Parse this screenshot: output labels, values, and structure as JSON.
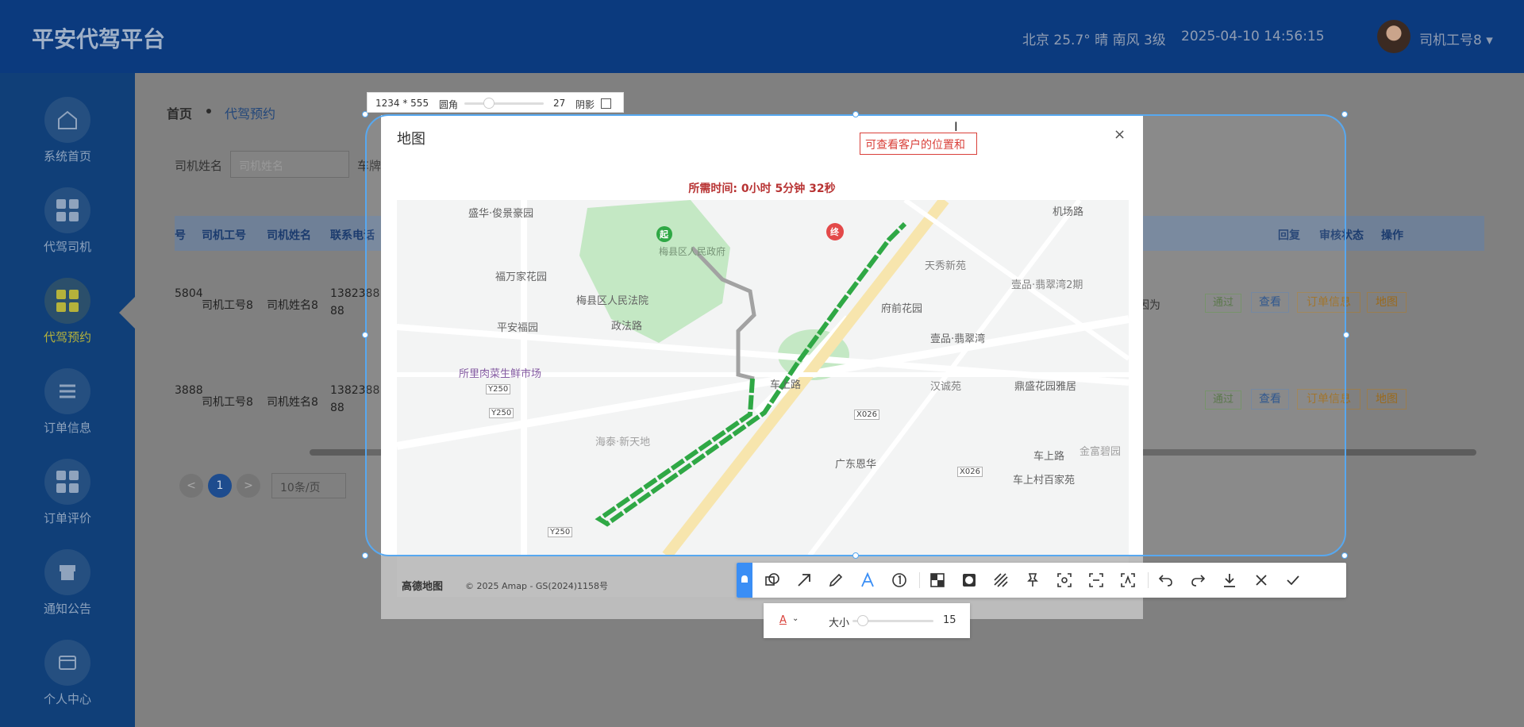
{
  "header": {
    "brand": "平安代驾平台",
    "weather": "北京 25.7° 晴 南风 3级",
    "datetime": "2025-04-10 14:56:15",
    "user": "司机工号8 ▾"
  },
  "sidebar": {
    "items": [
      {
        "label": "系统首页",
        "icon": "home-icon"
      },
      {
        "label": "代驾司机",
        "icon": "grid-icon"
      },
      {
        "label": "代驾预约",
        "icon": "grid-icon",
        "active": true
      },
      {
        "label": "订单信息",
        "icon": "list-icon"
      },
      {
        "label": "订单评价",
        "icon": "grid-icon"
      },
      {
        "label": "通知公告",
        "icon": "shop-icon"
      },
      {
        "label": "个人中心",
        "icon": "wallet-icon"
      }
    ]
  },
  "breadcrumb": {
    "home": "首页",
    "current": "代驾预约"
  },
  "filters": {
    "driver_name_label": "司机姓名",
    "driver_name_placeholder": "司机姓名",
    "plate_label": "车牌"
  },
  "table": {
    "headers_left": [
      "号",
      "司机工号",
      "司机姓名",
      "联系电话"
    ],
    "headers_right": [
      "回复",
      "审核状态",
      "操作"
    ],
    "rows": [
      {
        "id_tail": "5804",
        "driver_no": "司机工号8",
        "driver_name": "司机姓名8",
        "phone_a": "1382388",
        "phone_b": "88",
        "reply": "、因为",
        "status": "通过"
      },
      {
        "id_tail": "3888",
        "driver_no": "司机工号8",
        "driver_name": "司机姓名8",
        "phone_a": "1382388",
        "phone_b": "88",
        "reply": "",
        "status": "通过"
      }
    ],
    "actions": {
      "view": "查看",
      "order": "订单信息",
      "map": "地图"
    }
  },
  "pager": {
    "prev": "<",
    "page": "1",
    "next": ">",
    "size": "10条/页"
  },
  "selection_toolbar": {
    "size": "1234 * 555",
    "radius_label": "圆角",
    "radius_value": "27",
    "shadow_label": "阴影"
  },
  "dialog": {
    "title": "地图",
    "close": "×",
    "duration": "所需时间:   0小时 5分钟 32秒",
    "map_footer_logo": "高德地图",
    "map_footer_copy": "© 2025 Amap - GS(2024)1158号"
  },
  "map": {
    "labels": [
      "盛华·俊景豪园",
      "福万家花园",
      "梅县区人民法院",
      "平安福园",
      "政法路",
      "所里肉菜生鲜市场",
      "府前花园",
      "壹品·翡翠湾",
      "天秀新苑",
      "壹品·翡翠湾2期",
      "汉诚苑",
      "鼎盛花园雅居",
      "广东恩华",
      "车上村百家苑",
      "金富碧园",
      "机场路",
      "车上路",
      "车上路",
      "海泰·新天地",
      "梅县区人民政府"
    ],
    "road_tags": [
      "Y250",
      "Y250",
      "Y250",
      "X026",
      "X026"
    ],
    "start": "起",
    "end": "终"
  },
  "annotation": {
    "text": "可查看客户的位置和"
  },
  "draw_toolbar": {
    "size_label": "大小",
    "size_value": "15",
    "font_a": "A"
  },
  "colors": {
    "route": "#1ea136",
    "accent": "#3a8ef5",
    "annot": "#d9403a"
  }
}
